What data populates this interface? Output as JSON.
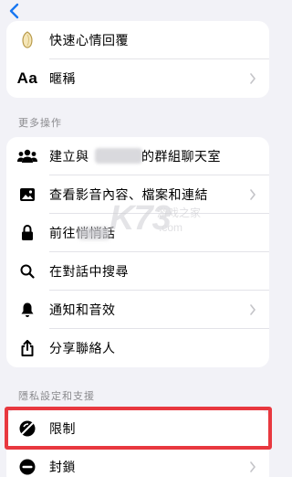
{
  "nav": {
    "back_icon": "chevron-left-icon",
    "accent": "#1877f2"
  },
  "top_group": {
    "items": [
      {
        "label": "快速心情回覆",
        "icon": "emoji-reaction-icon"
      },
      {
        "label": "暱稱",
        "icon_text": "Aa"
      }
    ]
  },
  "more_actions": {
    "title": "更多操作",
    "items": [
      {
        "label_prefix": "建立與",
        "label_suffix": "的群組聊天室",
        "icon": "group-icon"
      },
      {
        "label": "查看影音內容、檔案和連結",
        "icon": "photo-icon"
      },
      {
        "label": "前往悄悄話",
        "icon": "lock-icon"
      },
      {
        "label": "在對話中搜尋",
        "icon": "search-icon"
      },
      {
        "label": "通知和音效",
        "icon": "bell-icon"
      },
      {
        "label": "分享聯絡人",
        "icon": "share-icon"
      }
    ]
  },
  "privacy": {
    "title": "隱私設定和支援",
    "items": [
      {
        "label": "限制",
        "icon": "restrict-icon"
      },
      {
        "label": "封鎖",
        "icon": "block-icon"
      }
    ]
  },
  "watermark": {
    "big": "K73",
    "small": "游戏之家",
    "url": ".com"
  },
  "colors": {
    "highlight": "#e8383f",
    "background": "#f2f2f7"
  }
}
